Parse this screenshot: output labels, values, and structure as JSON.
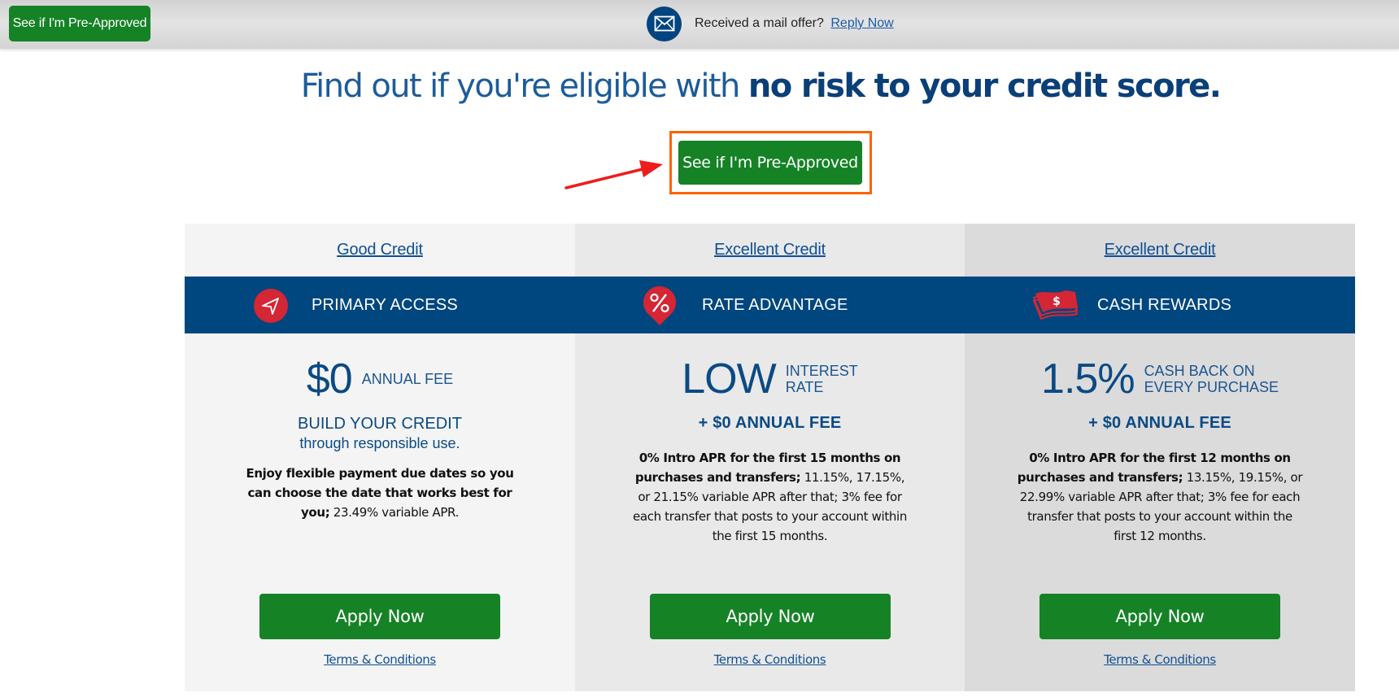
{
  "topbar": {
    "preapproved_button": "See if I'm Pre-Approved",
    "mail_icon": "envelope-icon",
    "mail_prompt": "Received a mail offer?",
    "mail_link": "Reply Now"
  },
  "headline": {
    "light": "Find out if you're eligible with ",
    "bold": "no risk to your credit score."
  },
  "cta": {
    "label": "See if I'm Pre-Approved",
    "highlight_color": "#ff6200",
    "annotation_arrow_color": "#ee1c1c"
  },
  "colors": {
    "brand_blue": "#00467f",
    "button_green": "#158226",
    "icon_red": "#d42635",
    "link_blue": "#0f4f94"
  },
  "cards": [
    {
      "tier": "Good Credit",
      "icon": "paper-plane-icon",
      "name": "PRIMARY ACCESS",
      "hero_big": "$0",
      "hero_small_1": "ANNUAL FEE",
      "hero_small_2": "",
      "sub_line1": "BUILD YOUR CREDIT",
      "sub_line2": "through responsible use.",
      "desc_bold": "Enjoy flexible payment due dates so you can choose the date that works best for you;",
      "desc_normal": " 23.49% variable APR.",
      "apply": "Apply Now",
      "terms": "Terms & Conditions"
    },
    {
      "tier": "Excellent Credit",
      "icon": "percent-tag-icon",
      "name": "RATE ADVANTAGE",
      "hero_big": "LOW",
      "hero_small_1": "INTEREST",
      "hero_small_2": "RATE",
      "plus_fee": "+ $0 ANNUAL FEE",
      "desc_bold": "0% Intro APR for the first 15 months on purchases and transfers;",
      "desc_normal": " 11.15%, 17.15%, or 21.15% variable APR after that; 3% fee for each transfer that posts to your account within the first 15 months.",
      "apply": "Apply Now",
      "terms": "Terms & Conditions"
    },
    {
      "tier": "Excellent Credit",
      "icon": "cash-stack-icon",
      "name": "CASH REWARDS",
      "hero_big": "1.5%",
      "hero_small_1": "CASH BACK ON",
      "hero_small_2": "EVERY PURCHASE",
      "plus_fee": "+ $0 ANNUAL FEE",
      "desc_bold": "0% Intro APR for the first 12 months on purchases and transfers;",
      "desc_normal": " 13.15%, 19.15%, or 22.99% variable APR after that; 3% fee for each transfer that posts to your account within the first 12 months.",
      "apply": "Apply Now",
      "terms": "Terms & Conditions"
    }
  ]
}
